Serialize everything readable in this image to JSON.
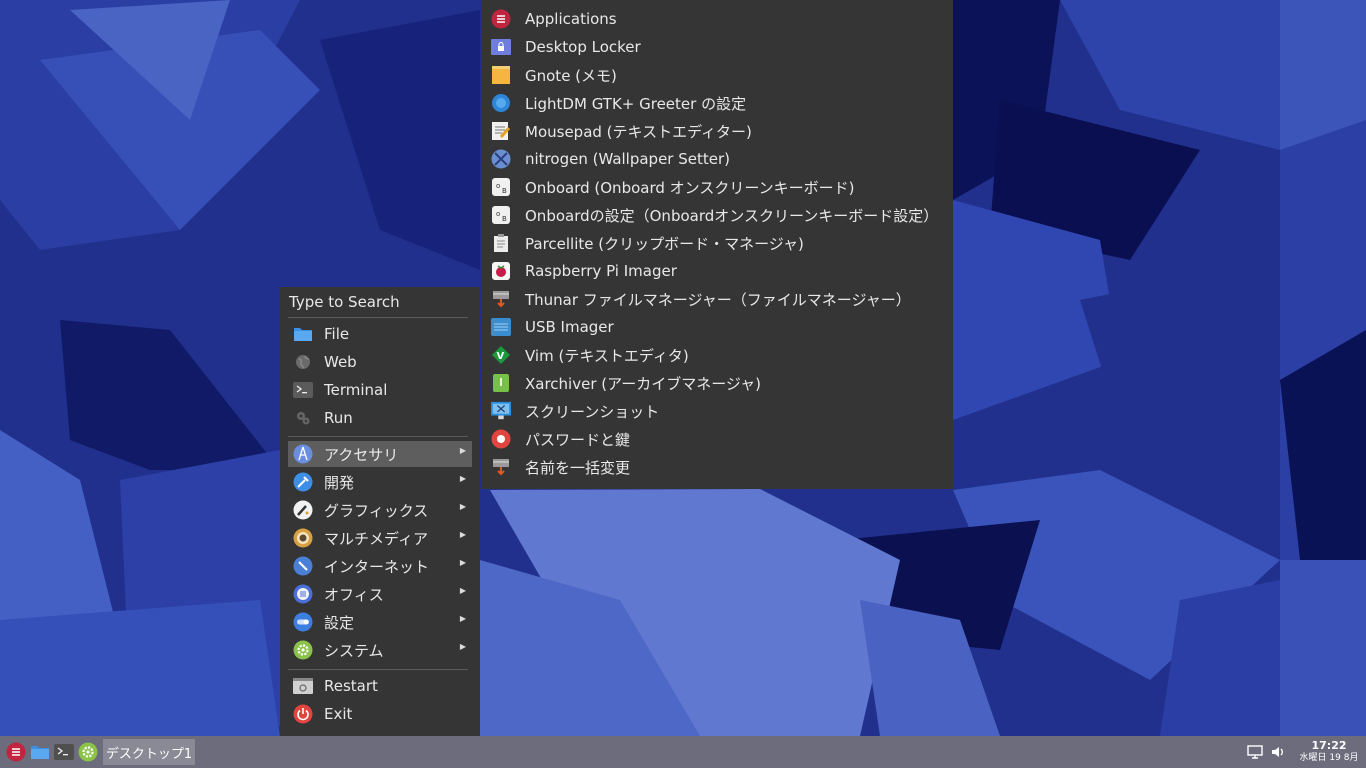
{
  "menu": {
    "search_placeholder": "Type to Search",
    "places": [
      {
        "label": "File",
        "icon": "folder-icon"
      },
      {
        "label": "Web",
        "icon": "globe-icon"
      },
      {
        "label": "Terminal",
        "icon": "terminal-icon"
      },
      {
        "label": "Run",
        "icon": "gear-run-icon"
      }
    ],
    "categories": [
      {
        "label": "アクセサリ",
        "icon": "compass-icon",
        "selected": true
      },
      {
        "label": "開発",
        "icon": "wrench-icon"
      },
      {
        "label": "グラフィックス",
        "icon": "brush-icon"
      },
      {
        "label": "マルチメディア",
        "icon": "speaker-icon"
      },
      {
        "label": "インターネット",
        "icon": "compass-needle-icon"
      },
      {
        "label": "オフィス",
        "icon": "document-icon"
      },
      {
        "label": "設定",
        "icon": "toggle-icon"
      },
      {
        "label": "システム",
        "icon": "system-gear-icon"
      }
    ],
    "session": [
      {
        "label": "Restart",
        "icon": "restart-icon"
      },
      {
        "label": "Exit",
        "icon": "power-icon"
      }
    ]
  },
  "submenu": {
    "items": [
      {
        "label": "Applications",
        "icon": "menu-icon"
      },
      {
        "label": "Desktop Locker",
        "icon": "lock-icon"
      },
      {
        "label": "Gnote (メモ)",
        "icon": "note-icon"
      },
      {
        "label": "LightDM GTK+ Greeter の設定",
        "icon": "lightdm-icon"
      },
      {
        "label": "Mousepad (テキストエディター)",
        "icon": "notepad-icon"
      },
      {
        "label": "nitrogen (Wallpaper Setter)",
        "icon": "nitrogen-icon"
      },
      {
        "label": "Onboard (Onboard オンスクリーンキーボード)",
        "icon": "keyboard-icon"
      },
      {
        "label": "Onboardの設定（Onboardオンスクリーンキーボード設定）",
        "icon": "keyboard-settings-icon"
      },
      {
        "label": "Parcellite (クリップボード・マネージャ)",
        "icon": "clipboard-icon"
      },
      {
        "label": "Raspberry Pi Imager",
        "icon": "raspberry-icon"
      },
      {
        "label": "Thunar ファイルマネージャー（ファイルマネージャー）",
        "icon": "thunar-icon"
      },
      {
        "label": "USB Imager",
        "icon": "usb-icon"
      },
      {
        "label": "Vim (テキストエディタ)",
        "icon": "vim-icon"
      },
      {
        "label": "Xarchiver (アーカイブマネージャ)",
        "icon": "archive-icon"
      },
      {
        "label": "スクリーンショット",
        "icon": "screenshot-icon"
      },
      {
        "label": "パスワードと鍵",
        "icon": "password-icon"
      },
      {
        "label": "名前を一括変更",
        "icon": "rename-icon"
      }
    ]
  },
  "taskbar": {
    "desktop_label": "デスクトップ1",
    "time": "17:22",
    "date": "水曜日 19 8月"
  },
  "colors": {
    "menu_bg": "#353535",
    "selected_bg": "#5e5e5e",
    "taskbar_bg": "#6c6c7c",
    "wallpaper_base": "#1f2f8c"
  }
}
